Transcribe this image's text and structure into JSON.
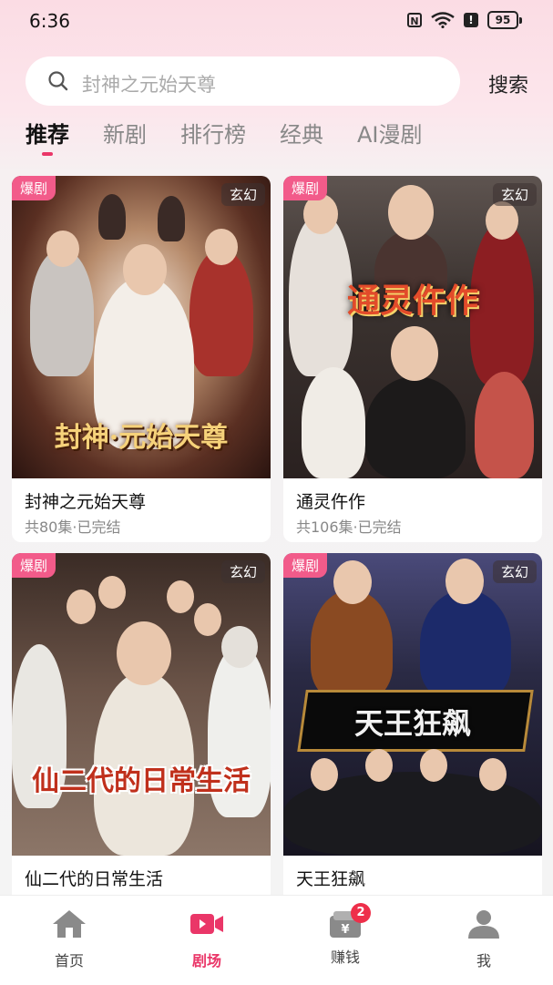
{
  "status_bar": {
    "time": "6:36",
    "battery": "95",
    "icons": [
      "nfc-icon",
      "wifi-icon",
      "alert-icon",
      "battery-icon"
    ]
  },
  "search": {
    "placeholder": "封神之元始天尊",
    "button_label": "搜索"
  },
  "tabs": [
    {
      "label": "推荐",
      "active": true
    },
    {
      "label": "新剧",
      "active": false
    },
    {
      "label": "排行榜",
      "active": false
    },
    {
      "label": "经典",
      "active": false
    },
    {
      "label": "AI漫剧",
      "active": false
    }
  ],
  "cards": [
    {
      "badge": "爆剧",
      "genre": "玄幻",
      "poster_text": "封神·元始天尊",
      "title": "封神之元始天尊",
      "meta": "共80集·已完结"
    },
    {
      "badge": "爆剧",
      "genre": "玄幻",
      "poster_text": "通灵仵作",
      "title": "通灵仵作",
      "meta": "共106集·已完结"
    },
    {
      "badge": "爆剧",
      "genre": "玄幻",
      "poster_text": "仙二代的日常生活",
      "title": "仙二代的日常生活",
      "meta": ""
    },
    {
      "badge": "爆剧",
      "genre": "玄幻",
      "poster_text": "天王狂飙",
      "title": "天王狂飙",
      "meta": ""
    }
  ],
  "bottom_nav": [
    {
      "label": "首页",
      "icon": "home-icon",
      "active": false
    },
    {
      "label": "剧场",
      "icon": "video-icon",
      "active": true
    },
    {
      "label": "赚钱",
      "icon": "wallet-icon",
      "active": false,
      "badge": "2"
    },
    {
      "label": "我",
      "icon": "profile-icon",
      "active": false
    }
  ],
  "colors": {
    "accent": "#ea3668",
    "badge": "#f25b8a"
  }
}
